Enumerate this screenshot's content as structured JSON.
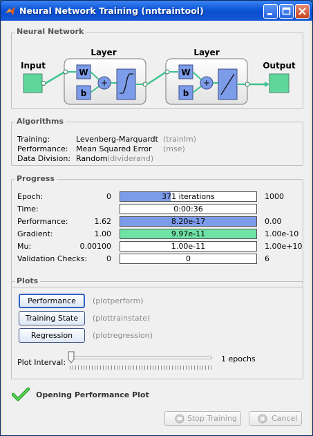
{
  "window": {
    "title": "Neural Network Training (nntraintool)"
  },
  "network": {
    "section_title": "Neural Network",
    "input_label": "Input",
    "output_label": "Output",
    "layers": [
      {
        "label": "Layer",
        "weight": "W",
        "bias": "b",
        "sum": "+",
        "transfer": "tansig"
      },
      {
        "label": "Layer",
        "weight": "W",
        "bias": "b",
        "sum": "+",
        "transfer": "purelin"
      }
    ]
  },
  "algorithms": {
    "section_title": "Algorithms",
    "rows": [
      {
        "label": "Training:",
        "value": "Levenberg-Marquardt",
        "fn": "(trainlm)"
      },
      {
        "label": "Performance:",
        "value": "Mean Squared Error",
        "fn": "(mse)"
      },
      {
        "label": "Data Division:",
        "value": "Random",
        "fn": "(dividerand)"
      }
    ]
  },
  "progress": {
    "section_title": "Progress",
    "rows": [
      {
        "label": "Epoch:",
        "start": "0",
        "value": "371 iterations",
        "end": "1000",
        "fill": 0.371,
        "color": "#7c9be8"
      },
      {
        "label": "Time:",
        "start": "",
        "value": "0:00:36",
        "end": "",
        "fill": 0,
        "color": "#7c9be8"
      },
      {
        "label": "Performance:",
        "start": "1.62",
        "value": "8.20e-17",
        "end": "0.00",
        "fill": 1.0,
        "color": "#7c9be8"
      },
      {
        "label": "Gradient:",
        "start": "1.00",
        "value": "9.97e-11",
        "end": "1.00e-10",
        "fill": 1.0,
        "color": "#6fe2a6"
      },
      {
        "label": "Mu:",
        "start": "0.00100",
        "value": "1.00e-11",
        "end": "1.00e+10",
        "fill": 0,
        "color": "#7c9be8"
      },
      {
        "label": "Validation Checks:",
        "start": "0",
        "value": "0",
        "end": "6",
        "fill": 0,
        "color": "#7c9be8"
      }
    ]
  },
  "plots": {
    "section_title": "Plots",
    "buttons": [
      {
        "label": "Performance",
        "fn": "(plotperform)"
      },
      {
        "label": "Training State",
        "fn": "(plottrainstate)"
      },
      {
        "label": "Regression",
        "fn": "(plotregression)"
      }
    ],
    "interval_label": "Plot Interval:",
    "interval_value": "1 epochs"
  },
  "status": {
    "text": "Opening Performance Plot",
    "color": "#2bb02b"
  },
  "footer": {
    "stop_label": "Stop Training",
    "cancel_label": "Cancel"
  }
}
